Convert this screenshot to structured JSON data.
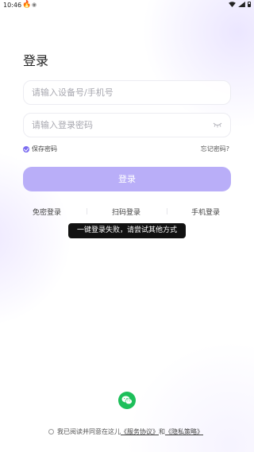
{
  "status_bar": {
    "time": "10:46",
    "notification_icon": "flame-icon",
    "extra_icon": "android-icon"
  },
  "login": {
    "title": "登录",
    "account_placeholder": "请输入设备号/手机号",
    "password_placeholder": "请输入登录密码",
    "remember_label": "保存密码",
    "remember_checked": true,
    "forgot_label": "忘记密码?",
    "login_button": "登录"
  },
  "alt_login": {
    "passwordless": "免密登录",
    "scan": "扫码登录",
    "phone": "手机登录"
  },
  "toast": "一键登录失败，请尝试其他方式",
  "agreement": {
    "prefix": "我已阅读并同意在这儿",
    "service_link": "《服务协议》",
    "and": "和",
    "privacy_link": "《隐私策略》"
  },
  "colors": {
    "accent": "#b9aef8",
    "check": "#7b6cf0",
    "wechat": "#1dbf5a"
  }
}
